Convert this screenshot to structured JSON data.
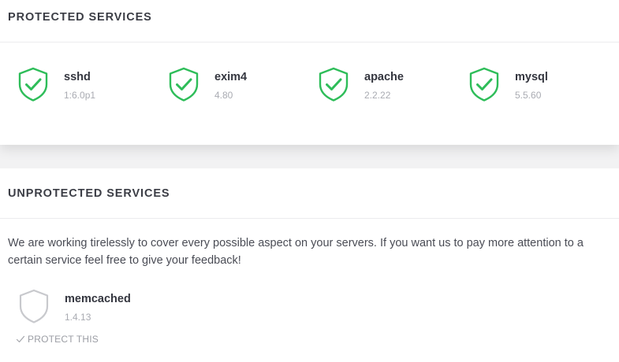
{
  "protected": {
    "title": "PROTECTED SERVICES",
    "services": [
      {
        "name": "sshd",
        "version": "1:6.0p1",
        "icon": "shield-check-icon"
      },
      {
        "name": "exim4",
        "version": "4.80",
        "icon": "shield-check-icon"
      },
      {
        "name": "apache",
        "version": "2.2.22",
        "icon": "shield-check-icon"
      },
      {
        "name": "mysql",
        "version": "5.5.60",
        "icon": "shield-check-icon"
      }
    ],
    "accent_color": "#2ebd59"
  },
  "unprotected": {
    "title": "UNPROTECTED SERVICES",
    "info": "We are working tirelessly to cover every possible aspect on your servers. If you want us to pay more attention to a certain service feel free to give your feedback!",
    "services": [
      {
        "name": "memcached",
        "version": "1.4.13",
        "icon": "shield-outline-icon",
        "action_label": "PROTECT THIS",
        "action_icon": "check-icon"
      }
    ],
    "muted_color": "#c8c9cd"
  }
}
